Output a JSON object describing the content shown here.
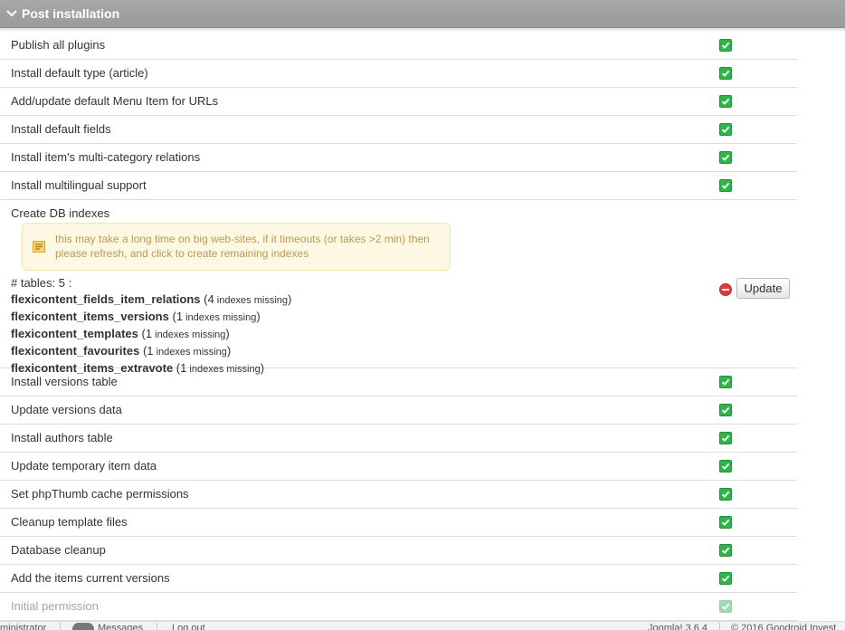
{
  "panel": {
    "title": "Post installation"
  },
  "tasks_top": [
    {
      "label": "Publish all plugins",
      "status": "ok"
    },
    {
      "label": "Install default type (article)",
      "status": "ok"
    },
    {
      "label": "Add/update default Menu Item for URLs",
      "status": "ok"
    },
    {
      "label": "Install default fields",
      "status": "ok"
    },
    {
      "label": "Install item's multi-category relations",
      "status": "ok"
    },
    {
      "label": "Install multilingual support",
      "status": "ok"
    }
  ],
  "db_indexes": {
    "label": "Create DB indexes",
    "notice": "this may take a long time on big web-sites, if it timeouts (or takes >2 min) then please refresh, and click to create remaining indexes",
    "tables_count": "# tables: 5 :",
    "tables": [
      {
        "name": "flexicontent_fields_item_relations",
        "open": " (",
        "count": "4",
        "missing": " indexes missing",
        "close": ")"
      },
      {
        "name": "flexicontent_items_versions",
        "open": " (",
        "count": "1",
        "missing": " indexes missing",
        "close": ")"
      },
      {
        "name": "flexicontent_templates",
        "open": " (",
        "count": "1",
        "missing": " indexes missing",
        "close": ")"
      },
      {
        "name": "flexicontent_favourites",
        "open": " (",
        "count": "1",
        "missing": " indexes missing",
        "close": ")"
      },
      {
        "name": "flexicontent_items_extravote",
        "open": " (",
        "count": "1",
        "missing": " indexes missing",
        "close": ")"
      }
    ],
    "status": "error",
    "update_label": "Update"
  },
  "tasks_bottom": [
    {
      "label": "Install versions table",
      "status": "ok"
    },
    {
      "label": "Update versions data",
      "status": "ok"
    },
    {
      "label": "Install authors table",
      "status": "ok"
    },
    {
      "label": "Update temporary item data",
      "status": "ok"
    },
    {
      "label": "Set phpThumb cache permissions",
      "status": "ok"
    },
    {
      "label": "Cleanup template files",
      "status": "ok"
    },
    {
      "label": "Database cleanup",
      "status": "ok"
    },
    {
      "label": "Add the items current versions",
      "status": "ok"
    },
    {
      "label": "Initial permission",
      "status": "ok"
    }
  ],
  "footer": {
    "admin": "ministrator",
    "messages": "Messages",
    "logout": "Log out",
    "version": "Joomla! 3.6.4",
    "copyright": "© 2016 Goodroid Invest"
  },
  "colors": {
    "header_bg": "#a0a0a0",
    "ok": "#2fb44a",
    "error": "#e0393e",
    "notice_bg": "#fcf8e3",
    "notice_text": "#c09853"
  },
  "icons": {
    "header": "chevron-down-icon",
    "ok": "check-icon",
    "error": "minus-circle-icon",
    "notice": "note-icon"
  }
}
